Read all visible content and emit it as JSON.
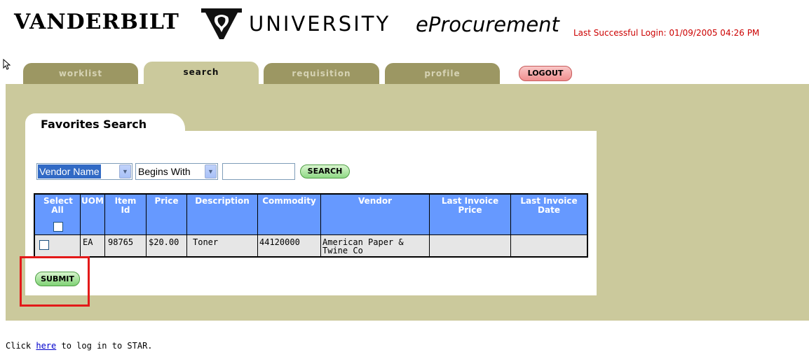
{
  "header": {
    "brand_left": "VANDERBILT",
    "brand_right": "UNIVERSITY",
    "product": "eProcurement",
    "last_login": "Last Successful Login: 01/09/2005 04:26 PM",
    "logo_icon": "vanderbilt-v-oak-logo-icon",
    "cursor_icon": "mouse-pointer-icon"
  },
  "tabs": [
    {
      "label": "worklist",
      "active": false
    },
    {
      "label": "search",
      "active": true
    },
    {
      "label": "requisition",
      "active": false
    },
    {
      "label": "profile",
      "active": false
    }
  ],
  "logout_label": "LOGOUT",
  "panel": {
    "title": "Favorites Search"
  },
  "search": {
    "field_value": "Vendor Name",
    "operator_value": "Begins With",
    "query_value": "",
    "button_label": "SEARCH"
  },
  "table": {
    "headers": [
      "Select All",
      "UOM",
      "Item Id",
      "Price",
      "Description",
      "Commodity",
      "Vendor",
      "Last Invoice Price",
      "Last Invoice Date"
    ],
    "rows": [
      {
        "uom": "EA",
        "item_id": "98765",
        "price": "$20.00",
        "description": "Toner",
        "commodity": "44120000",
        "vendor": "American Paper & Twine Co",
        "last_invoice_price": "",
        "last_invoice_date": ""
      }
    ]
  },
  "submit_label": "SUBMIT",
  "footer": {
    "prefix": "Click ",
    "link": "here",
    "suffix": " to log in to STAR."
  },
  "colors": {
    "band": "#cbc99c",
    "tab_inactive": "#9c9763",
    "table_header": "#6699ff",
    "row_bg": "#e6e6e6",
    "highlight_box": "#e31919",
    "login_text": "#cc0000"
  }
}
